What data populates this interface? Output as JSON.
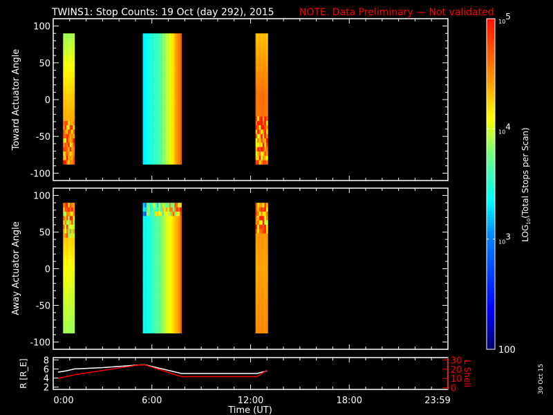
{
  "title": {
    "main": "TWINS1: Stop Counts: 19 Oct (day 292), 2015",
    "note": "NOTE. Data Preliminary — Not validated"
  },
  "side_date": "30 Oct 15",
  "colors": {
    "background": "#000000",
    "axes": "#ffffff",
    "note": "#ff0000",
    "lshell": "#ff0000",
    "radius": "#ffffff"
  },
  "chart_data": [
    {
      "type": "heatmap",
      "name": "toward",
      "ylabel": "Toward Actuator Angle",
      "ylim": [
        -110,
        110
      ],
      "yticks": [
        "100",
        "50",
        "0",
        "-50",
        "-100"
      ],
      "ytick_values": [
        100,
        50,
        0,
        -50,
        -100
      ],
      "xlim_hours": [
        0,
        24
      ],
      "angle_range": [
        -88,
        90
      ],
      "bands": [
        {
          "start_h": 0.6,
          "end_h": 1.3,
          "profile": "top-green-to-orange-noisy-below-minus30",
          "log_top": 3.9,
          "log_mid": 4.3,
          "log_bottom": 4.6,
          "noisy_below": -30
        },
        {
          "start_h": 5.45,
          "end_h": 7.8,
          "profile": "cyan-to-orange-by-time",
          "log_left": 3.35,
          "log_right": 4.6,
          "noisy_below": -999
        },
        {
          "start_h": 12.3,
          "end_h": 13.05,
          "profile": "orange-noisy-below-minus25",
          "log_top": 4.3,
          "log_mid": 4.6,
          "log_bottom": 4.5,
          "noisy_below": -25
        }
      ]
    },
    {
      "type": "heatmap",
      "name": "away",
      "ylabel": "Away Actuator Angle",
      "ylim": [
        -110,
        110
      ],
      "yticks": [
        "100",
        "50",
        "0",
        "-50",
        "-100"
      ],
      "ytick_values": [
        100,
        50,
        0,
        -50,
        -100
      ],
      "xlim_hours": [
        0,
        24
      ],
      "angle_range": [
        -88,
        90
      ],
      "bands": [
        {
          "start_h": 0.6,
          "end_h": 1.3,
          "profile": "noisy-top-yellow-green-below",
          "log_top": 4.5,
          "log_mid": 4.1,
          "log_bottom": 3.9,
          "noisy_above": 40
        },
        {
          "start_h": 5.45,
          "end_h": 7.8,
          "profile": "cyan-to-orange-by-time-hot-top",
          "log_left": 3.4,
          "log_right": 4.6,
          "noisy_above": 75
        },
        {
          "start_h": 12.3,
          "end_h": 13.05,
          "profile": "orange-noisy-top",
          "log_top": 4.5,
          "log_mid": 4.4,
          "log_bottom": 4.5,
          "noisy_above": 50
        }
      ]
    },
    {
      "type": "line",
      "name": "orbit",
      "ylabel": "R [R_E]",
      "ylabel_main": "R [R",
      "ylabel_sub": "E",
      "ylabel_close": "]",
      "ylim": [
        1.5,
        8.5
      ],
      "yticks": [
        "8",
        "6",
        "4",
        "2"
      ],
      "ytick_values": [
        8,
        6,
        4,
        2
      ],
      "y2label": "L Shell",
      "y2lim": [
        -1.75,
        32.5
      ],
      "y2ticks": [
        "30",
        "20",
        "10",
        "0"
      ],
      "y2tick_values": [
        30,
        20,
        10,
        0
      ],
      "xlabel": "Time (UT)",
      "xticks": [
        "0:00",
        "6:00",
        "12:00",
        "18:00",
        "23:59"
      ],
      "xtick_hours": [
        0,
        6,
        12,
        18,
        24
      ],
      "series": [
        {
          "name": "R",
          "axis": "left",
          "x_hours": [
            0.3,
            0.8,
            1.3,
            3.0,
            5.3,
            5.6,
            7.8,
            12.4,
            13.0
          ],
          "values": [
            5.3,
            5.6,
            6.0,
            6.3,
            6.9,
            6.9,
            5.0,
            5.0,
            5.6
          ]
        },
        {
          "name": "L Shell",
          "axis": "right",
          "x_hours": [
            0.3,
            1.3,
            5.2,
            5.6,
            7.8,
            12.4,
            13.0
          ],
          "values": [
            10,
            14,
            24.5,
            24.5,
            12,
            12,
            19
          ]
        }
      ]
    }
  ],
  "colorbar": {
    "title_main": "LOG",
    "title_sub": "10",
    "title_rest": "(Total Stops per Scan)",
    "log_range": [
      2,
      5
    ],
    "labels": [
      {
        "base": "10",
        "exp": "5",
        "log": 5
      },
      {
        "base": "10",
        "exp": "4",
        "log": 4
      },
      {
        "base": "10",
        "exp": "3",
        "log": 3
      },
      {
        "base": "100",
        "exp": "",
        "log": 2
      }
    ]
  }
}
